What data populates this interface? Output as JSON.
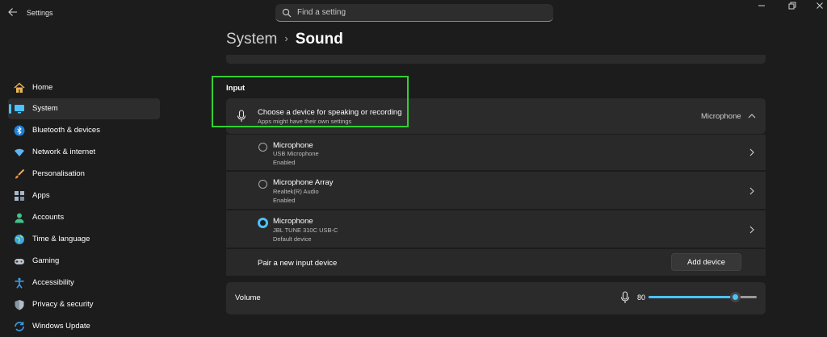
{
  "window": {
    "title": "Settings",
    "back_icon": "back-arrow-icon",
    "controls": [
      "minimize-icon",
      "maximize-icon",
      "close-icon"
    ]
  },
  "search": {
    "placeholder": "Find a setting",
    "value": ""
  },
  "sidebar": {
    "items": [
      {
        "label": "Home",
        "icon": "home-icon",
        "selected": false
      },
      {
        "label": "System",
        "icon": "system-icon",
        "selected": true
      },
      {
        "label": "Bluetooth & devices",
        "icon": "bluetooth-icon",
        "selected": false
      },
      {
        "label": "Network & internet",
        "icon": "wifi-icon",
        "selected": false
      },
      {
        "label": "Personalisation",
        "icon": "brush-icon",
        "selected": false
      },
      {
        "label": "Apps",
        "icon": "apps-icon",
        "selected": false
      },
      {
        "label": "Accounts",
        "icon": "person-icon",
        "selected": false
      },
      {
        "label": "Time & language",
        "icon": "globe-icon",
        "selected": false
      },
      {
        "label": "Gaming",
        "icon": "gamepad-icon",
        "selected": false
      },
      {
        "label": "Accessibility",
        "icon": "accessibility-icon",
        "selected": false
      },
      {
        "label": "Privacy & security",
        "icon": "shield-icon",
        "selected": false
      },
      {
        "label": "Windows Update",
        "icon": "update-icon",
        "selected": false
      }
    ]
  },
  "breadcrumb": {
    "parent": "System",
    "separator": "›",
    "current": "Sound"
  },
  "input": {
    "section_title": "Input",
    "chooser": {
      "title": "Choose a device for speaking or recording",
      "subtitle": "Apps might have their own settings",
      "value": "Microphone",
      "expanded": true
    },
    "devices": [
      {
        "name": "Microphone",
        "detail": "USB Microphone",
        "status": "Enabled",
        "selected": false
      },
      {
        "name": "Microphone Array",
        "detail": "Realtek(R) Audio",
        "status": "Enabled",
        "selected": false
      },
      {
        "name": "Microphone",
        "detail": "JBL TUNE 310C USB-C",
        "status": "Default device",
        "selected": true
      }
    ],
    "pair": {
      "label": "Pair a new input device",
      "button": "Add device"
    },
    "volume": {
      "label": "Volume",
      "value": "80",
      "level": 0.8
    }
  },
  "colors": {
    "accent": "#4cc2ff",
    "background": "#1c1c1c",
    "card": "#2b2b2b",
    "highlight": "#33d033"
  }
}
